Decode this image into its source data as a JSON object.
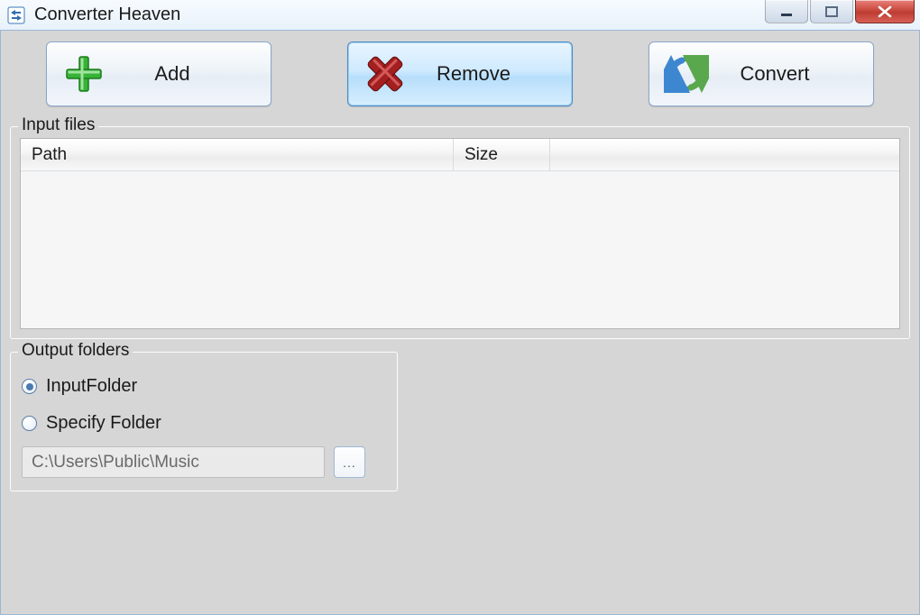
{
  "window": {
    "title": "Converter Heaven"
  },
  "toolbar": {
    "add_label": "Add",
    "remove_label": "Remove",
    "convert_label": "Convert",
    "selected": "remove"
  },
  "input_files": {
    "legend": "Input files",
    "columns": {
      "path": "Path",
      "size": "Size"
    },
    "rows": []
  },
  "output": {
    "legend": "Output folders",
    "radio_input_folder_label": "InputFolder",
    "radio_specify_folder_label": "Specify Folder",
    "selected_radio": "input_folder",
    "folder_path": "C:\\Users\\Public\\Music",
    "browse_label": "..."
  }
}
